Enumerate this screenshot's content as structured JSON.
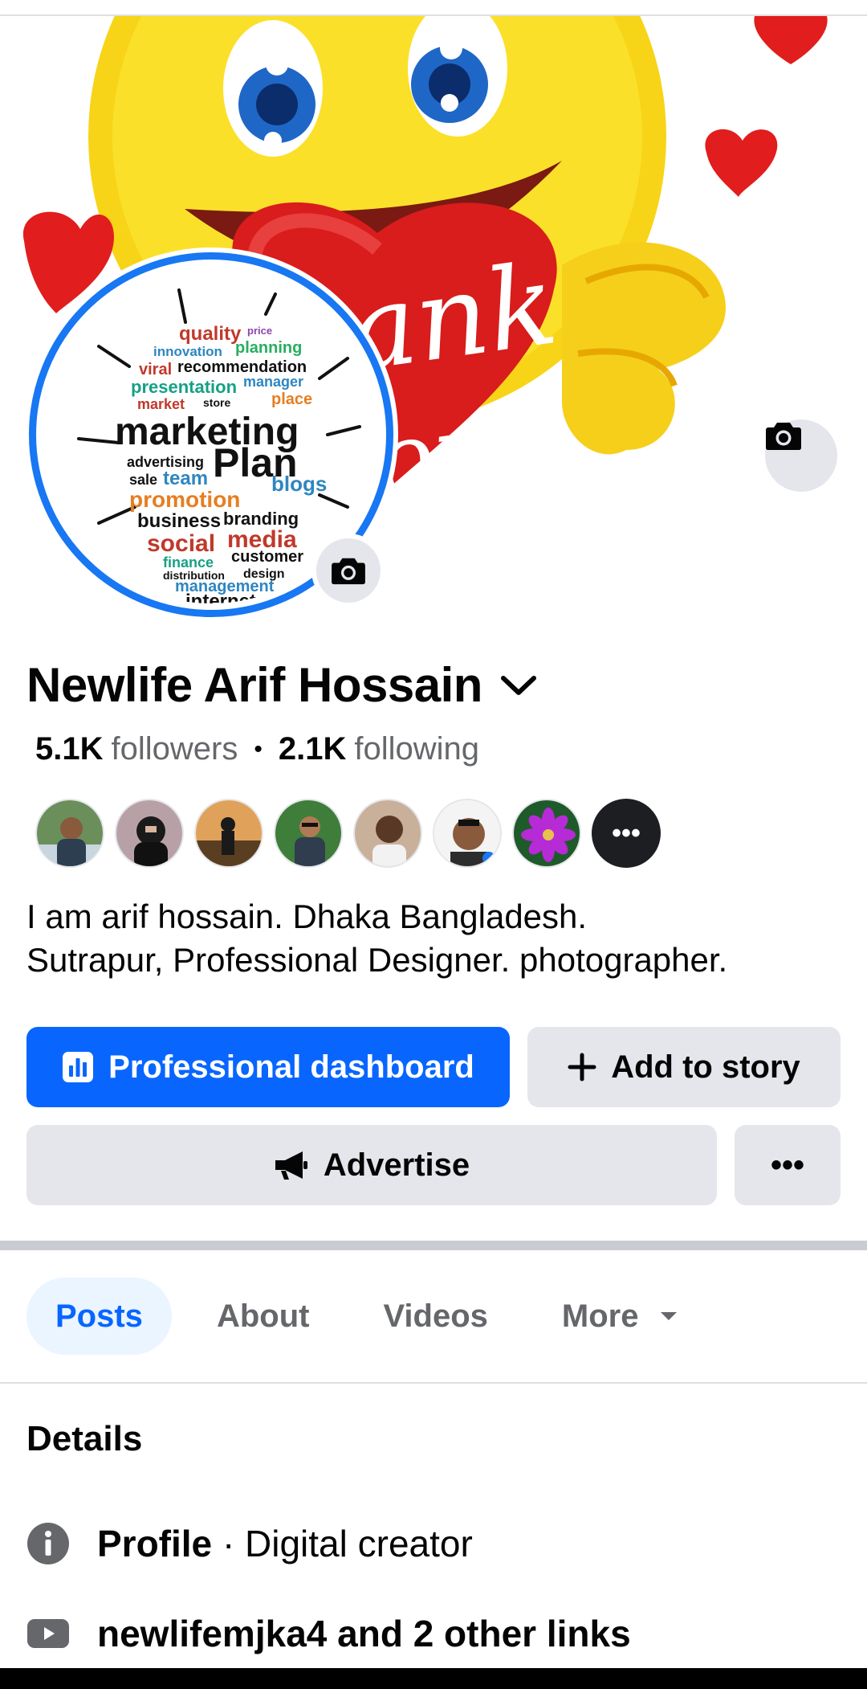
{
  "profile": {
    "name": "Newlife Arif Hossain",
    "followers_count": "5.1K",
    "followers_label": "followers",
    "following_count": "2.1K",
    "following_label": "following",
    "bio_line1": "I am arif hossain. Dhaka Bangladesh.",
    "bio_line2": "Sutrapur, Professional Designer. photographer.",
    "avatar_words": [
      "quality",
      "innovation",
      "planning",
      "viral",
      "recommendation",
      "presentation",
      "manager",
      "market",
      "store",
      "place",
      "marketing",
      "advertising",
      "Plan",
      "sale",
      "team",
      "blogs",
      "promotion",
      "business",
      "branding",
      "social",
      "media",
      "finance",
      "customer",
      "distribution",
      "design",
      "management",
      "internet"
    ],
    "cover_text": "Thank You"
  },
  "friends_more_label": "•••",
  "actions": {
    "dashboard_label": "Professional dashboard",
    "add_story_label": "Add to story",
    "advertise_label": "Advertise",
    "more_label": "•••"
  },
  "tabs": [
    {
      "label": "Posts",
      "active": true
    },
    {
      "label": "About",
      "active": false
    },
    {
      "label": "Videos",
      "active": false
    },
    {
      "label": "More",
      "active": false
    }
  ],
  "details": {
    "heading": "Details",
    "profile_label": "Profile",
    "profile_value": "· Digital creator",
    "links_text": "newlifemjka4 and 2 other links"
  },
  "icons": {
    "cover_camera": "camera-icon",
    "avatar_camera": "camera-icon",
    "name_dropdown": "chevron-down-icon",
    "dashboard": "bar-chart-icon",
    "story": "plus-icon",
    "advertise": "megaphone-icon",
    "info": "info-icon",
    "links": "youtube-icon"
  },
  "colors": {
    "accent": "#0866ff",
    "avatar_ring": "#1877f2",
    "button_gray": "#e4e6eb",
    "tab_active_bg": "#ebf5ff",
    "muted_text": "#65676b"
  }
}
